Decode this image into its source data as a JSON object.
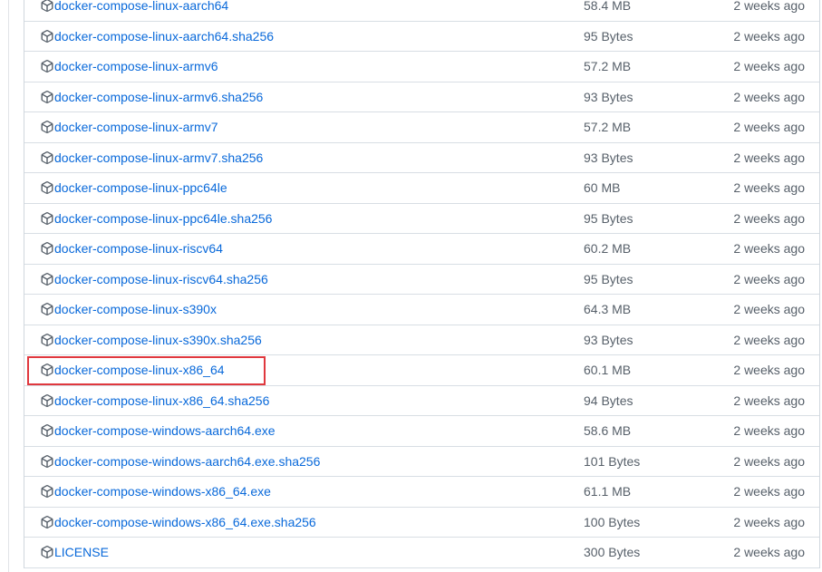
{
  "assets": [
    {
      "name": "docker-compose-linux-aarch64",
      "size": "58.4 MB",
      "time": "2 weeks ago"
    },
    {
      "name": "docker-compose-linux-aarch64.sha256",
      "size": "95 Bytes",
      "time": "2 weeks ago"
    },
    {
      "name": "docker-compose-linux-armv6",
      "size": "57.2 MB",
      "time": "2 weeks ago"
    },
    {
      "name": "docker-compose-linux-armv6.sha256",
      "size": "93 Bytes",
      "time": "2 weeks ago"
    },
    {
      "name": "docker-compose-linux-armv7",
      "size": "57.2 MB",
      "time": "2 weeks ago"
    },
    {
      "name": "docker-compose-linux-armv7.sha256",
      "size": "93 Bytes",
      "time": "2 weeks ago"
    },
    {
      "name": "docker-compose-linux-ppc64le",
      "size": "60 MB",
      "time": "2 weeks ago"
    },
    {
      "name": "docker-compose-linux-ppc64le.sha256",
      "size": "95 Bytes",
      "time": "2 weeks ago"
    },
    {
      "name": "docker-compose-linux-riscv64",
      "size": "60.2 MB",
      "time": "2 weeks ago"
    },
    {
      "name": "docker-compose-linux-riscv64.sha256",
      "size": "95 Bytes",
      "time": "2 weeks ago"
    },
    {
      "name": "docker-compose-linux-s390x",
      "size": "64.3 MB",
      "time": "2 weeks ago"
    },
    {
      "name": "docker-compose-linux-s390x.sha256",
      "size": "93 Bytes",
      "time": "2 weeks ago"
    },
    {
      "name": "docker-compose-linux-x86_64",
      "size": "60.1 MB",
      "time": "2 weeks ago"
    },
    {
      "name": "docker-compose-linux-x86_64.sha256",
      "size": "94 Bytes",
      "time": "2 weeks ago"
    },
    {
      "name": "docker-compose-windows-aarch64.exe",
      "size": "58.6 MB",
      "time": "2 weeks ago"
    },
    {
      "name": "docker-compose-windows-aarch64.exe.sha256",
      "size": "101 Bytes",
      "time": "2 weeks ago"
    },
    {
      "name": "docker-compose-windows-x86_64.exe",
      "size": "61.1 MB",
      "time": "2 weeks ago"
    },
    {
      "name": "docker-compose-windows-x86_64.exe.sha256",
      "size": "100 Bytes",
      "time": "2 weeks ago"
    },
    {
      "name": "LICENSE",
      "size": "300 Bytes",
      "time": "2 weeks ago"
    }
  ],
  "icon": "package-icon",
  "colors": {
    "link": "#0969da",
    "muted": "#57606a",
    "border": "#d8dee4",
    "highlight": "#e0383e"
  },
  "highlighted_index": 12
}
